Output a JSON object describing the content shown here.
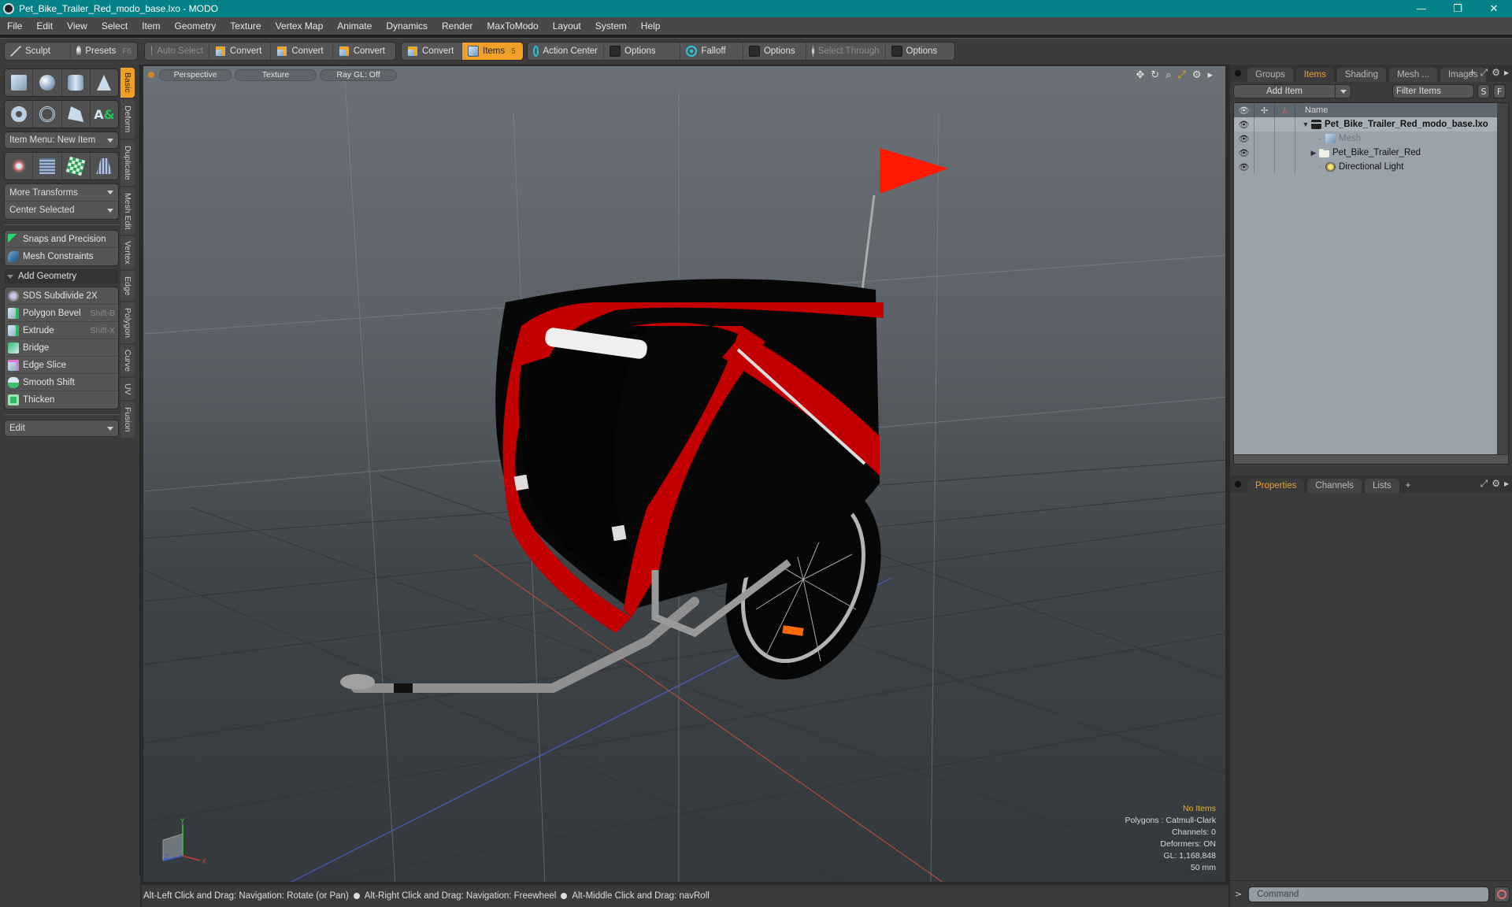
{
  "window": {
    "title": "Pet_Bike_Trailer_Red_modo_base.lxo - MODO",
    "controls": {
      "minimize": "—",
      "maximize": "❐",
      "close": "✕"
    }
  },
  "menu": [
    "File",
    "Edit",
    "View",
    "Select",
    "Item",
    "Geometry",
    "Texture",
    "Vertex Map",
    "Animate",
    "Dynamics",
    "Render",
    "MaxToModo",
    "Layout",
    "System",
    "Help"
  ],
  "toolbar": {
    "sculpt": "Sculpt",
    "presets": "Presets",
    "presets_hotkey": "F6",
    "auto_select": "Auto Select",
    "convert": [
      "Convert",
      "Convert",
      "Convert",
      "Convert"
    ],
    "items": "Items",
    "items_hotkey": "5",
    "action_center": "Action Center",
    "options": [
      "Options",
      "Options",
      "Options"
    ],
    "falloff": "Falloff",
    "select_through": "Select Through"
  },
  "left_panel": {
    "item_menu": "Item Menu: New Item",
    "more_transforms": "More Transforms",
    "center_selected": "Center Selected",
    "snaps": "Snaps and Precision",
    "mesh_constraints": "Mesh Constraints",
    "add_geometry": "Add Geometry",
    "tools": [
      {
        "label": "SDS Subdivide 2X",
        "hotkey": ""
      },
      {
        "label": "Polygon Bevel",
        "hotkey": "Shift-B"
      },
      {
        "label": "Extrude",
        "hotkey": "Shift-X"
      },
      {
        "label": "Bridge",
        "hotkey": ""
      },
      {
        "label": "Edge Slice",
        "hotkey": ""
      },
      {
        "label": "Smooth Shift",
        "hotkey": ""
      },
      {
        "label": "Thicken",
        "hotkey": ""
      }
    ],
    "edit_dropdown": "Edit",
    "vertical_tabs": [
      "Basic",
      "Deform",
      "Duplicate",
      "Mesh Edit",
      "Vertex",
      "Edge",
      "Polygon",
      "Curve",
      "UV",
      "Fusion"
    ],
    "active_vertical_tab": "Basic"
  },
  "viewport": {
    "view": "Perspective",
    "shading": "Texture",
    "raygl": "Ray GL: Off",
    "stats": {
      "selection": "No Items",
      "polygons": "Polygons : Catmull-Clark",
      "channels": "Channels: 0",
      "deformers": "Deformers: ON",
      "gl": "GL: 1,168,848",
      "units": "50 mm"
    },
    "axis_labels": {
      "x": "X",
      "y": "Y",
      "z": "Z"
    },
    "colors": {
      "trailer_red": "#c30000",
      "fabric_black": "#050505",
      "frame_grey": "#9a9a9a",
      "reflector_orange": "#ff6a00",
      "flag_red": "#ff1a00"
    }
  },
  "right_panel": {
    "tabs": [
      "Groups",
      "Items",
      "Shading",
      "Mesh ...",
      "Images"
    ],
    "active_tab": "Items",
    "add_item": "Add Item",
    "filter": "Filter Items",
    "filter_buttons": [
      "S",
      "F"
    ],
    "column_name": "Name",
    "items": [
      {
        "name": "Pet_Bike_Trailer_Red_modo_base.lxo",
        "type": "scene",
        "bold": true,
        "expanded": true
      },
      {
        "name": "Mesh",
        "type": "mesh",
        "dim": true
      },
      {
        "name": "Pet_Bike_Trailer_Red",
        "type": "group",
        "collapsed": true
      },
      {
        "name": "Directional Light",
        "type": "light"
      }
    ],
    "prop_tabs": [
      "Properties",
      "Channels",
      "Lists"
    ],
    "active_prop_tab": "Properties",
    "command_placeholder": "Command"
  },
  "status": {
    "hints": [
      "Alt-Left Click and Drag: Navigation: Rotate (or Pan)",
      "Alt-Right Click and Drag: Navigation: Freewheel",
      "Alt-Middle Click and Drag: navRoll"
    ]
  },
  "accent_color": "#f0a028"
}
